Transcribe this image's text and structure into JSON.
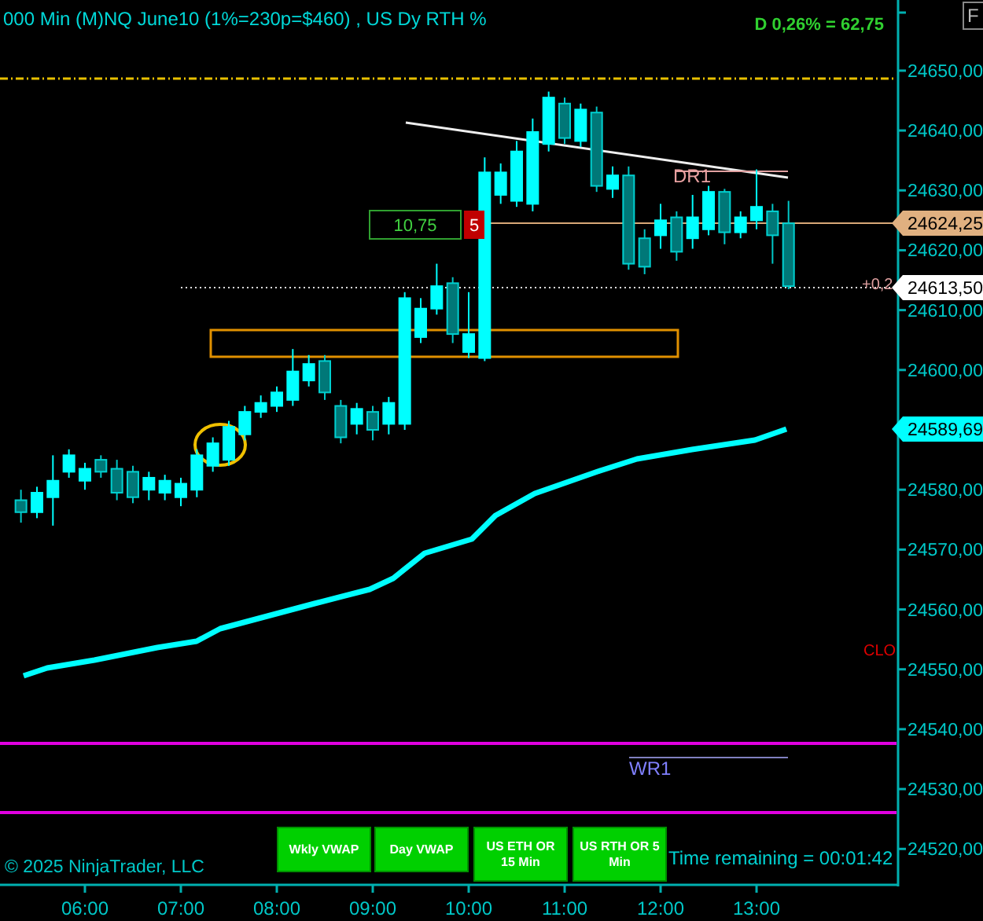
{
  "title": "000 Min (M)NQ June10 (1%=230p=$460) , US Dy RTH %",
  "daily_change": "D 0,26% = 62,75",
  "corner_button": "F",
  "price_chart": {
    "chart_data": {
      "type": "candlestick",
      "xlim": [
        306.9,
        868.5
      ],
      "ylim": [
        24514,
        24661.8
      ],
      "x": [
        320,
        330,
        340,
        350,
        360,
        370,
        380,
        390,
        400,
        410,
        420,
        430,
        440,
        450,
        460,
        470,
        480,
        490,
        500,
        510,
        520,
        530,
        540,
        550,
        560,
        570,
        580,
        590,
        600,
        610,
        620,
        630,
        640,
        650,
        660,
        670,
        680,
        690,
        700,
        710,
        720,
        730,
        740,
        750,
        760,
        770,
        780,
        790,
        800
      ],
      "xticks": [
        {
          "value": 360,
          "label": "06:00"
        },
        {
          "value": 420,
          "label": "07:00"
        },
        {
          "value": 480,
          "label": "08:00"
        },
        {
          "value": 540,
          "label": "09:00"
        },
        {
          "value": 600,
          "label": "10:00"
        },
        {
          "value": 660,
          "label": "11:00"
        },
        {
          "value": 720,
          "label": "12:00"
        },
        {
          "value": 780,
          "label": "13:00"
        }
      ],
      "yticks": [
        {
          "value": 24650,
          "label": "24650,00"
        },
        {
          "value": 24640,
          "label": "24640,00"
        },
        {
          "value": 24630,
          "label": "24630,00"
        },
        {
          "value": 24620,
          "label": "24620,00"
        },
        {
          "value": 24610,
          "label": "24610,00"
        },
        {
          "value": 24600,
          "label": "24600,00"
        },
        {
          "value": 24580,
          "label": "24580,00"
        },
        {
          "value": 24570,
          "label": "24570,00"
        },
        {
          "value": 24560,
          "label": "24560,00"
        },
        {
          "value": 24550,
          "label": "24550,00"
        },
        {
          "value": 24540,
          "label": "24540,00"
        },
        {
          "value": 24530,
          "label": "24530,00"
        },
        {
          "value": 24520,
          "label": "24520,00"
        }
      ],
      "ohlc": [
        [
          24578.25,
          24580,
          24574.5,
          24576.25
        ],
        [
          24576.25,
          24580.5,
          24575.25,
          24579.5
        ],
        [
          24578.75,
          24585.75,
          24574,
          24581.5
        ],
        [
          24583,
          24586.75,
          24582,
          24585.75
        ],
        [
          24581.5,
          24584.5,
          24580,
          24583.5
        ],
        [
          24585,
          24585.75,
          24582,
          24583
        ],
        [
          24583.5,
          24585,
          24578.25,
          24579.5
        ],
        [
          24583,
          24584,
          24577.75,
          24578.75
        ],
        [
          24580,
          24583,
          24578.25,
          24582
        ],
        [
          24579.5,
          24582.5,
          24578.25,
          24581.5
        ],
        [
          24578.75,
          24582,
          24577.25,
          24581
        ],
        [
          24580,
          24586.75,
          24578.75,
          24585.75
        ],
        [
          24584,
          24588.75,
          24583,
          24587.75
        ],
        [
          24585,
          24591.5,
          24584,
          24590.5
        ],
        [
          24589.25,
          24594,
          24588.25,
          24593
        ],
        [
          24593,
          24595.75,
          24592,
          24594.5
        ],
        [
          24594,
          24597.25,
          24593,
          24596.25
        ],
        [
          24595,
          24603.5,
          24594,
          24599.75
        ],
        [
          24598.25,
          24602.5,
          24597.25,
          24601
        ],
        [
          24601.5,
          24602.5,
          24595,
          24596.25
        ],
        [
          24594,
          24595,
          24587.75,
          24588.75
        ],
        [
          24591,
          24594.5,
          24589.25,
          24593.5
        ],
        [
          24593,
          24594,
          24588.25,
          24590
        ],
        [
          24591,
          24595.5,
          24589.25,
          24594.5
        ],
        [
          24591,
          24613,
          24590,
          24612
        ],
        [
          24605.5,
          24612,
          24604.5,
          24610.25
        ],
        [
          24610.25,
          24617.75,
          24609.25,
          24614
        ],
        [
          24614.5,
          24615.5,
          24604.5,
          24606
        ],
        [
          24603,
          24613,
          24602,
          24606
        ],
        [
          24602,
          24635.5,
          24601.5,
          24633
        ],
        [
          24629.25,
          24634.5,
          24627.75,
          24633
        ],
        [
          24628.25,
          24638.25,
          24627.25,
          24636.5
        ],
        [
          24627.75,
          24642,
          24626.5,
          24639.75
        ],
        [
          24637.75,
          24646.5,
          24636.5,
          24645.5
        ],
        [
          24644.5,
          24645.5,
          24637.75,
          24638.75
        ],
        [
          24638.25,
          24644.5,
          24637.25,
          24643.5
        ],
        [
          24643,
          24644,
          24629.75,
          24630.75
        ],
        [
          24630.25,
          24634,
          24628.75,
          24632.5
        ],
        [
          24632.5,
          24634,
          24616.75,
          24617.75
        ],
        [
          24622,
          24623.5,
          24616,
          24617.25
        ],
        [
          24622.5,
          24627.75,
          24620.25,
          24625
        ],
        [
          24625.5,
          24626.5,
          24618.25,
          24619.75
        ],
        [
          24622,
          24629.25,
          24620.25,
          24625.5
        ],
        [
          24623.5,
          24630.75,
          24622.5,
          24629.75
        ],
        [
          24629.75,
          24630.25,
          24621,
          24623
        ],
        [
          24623,
          24626.5,
          24622,
          24625.5
        ],
        [
          24625,
          24633.5,
          24623.5,
          24627.25
        ],
        [
          24626.5,
          24627.75,
          24617.75,
          24622.5
        ],
        [
          24624.5,
          24628.25,
          24613.5,
          24614
        ]
      ]
    }
  },
  "price_markers": [
    {
      "text": "24624,25",
      "kind": "position"
    },
    {
      "text": "24613,50",
      "kind": "last"
    },
    {
      "text": "24589,69",
      "kind": "average"
    }
  ],
  "position_box": {
    "profit": "10,75",
    "quantity": "5"
  },
  "labels": [
    {
      "text": "DR1",
      "kind": "daily"
    },
    {
      "text": "WR1",
      "kind": "weekly"
    },
    {
      "text": "CLO",
      "kind": "close"
    },
    {
      "text": "+0,2",
      "kind": "offset"
    }
  ],
  "indicator_buttons": [
    "Wkly VWAP",
    "Day VWAP",
    "US ETH OR 15 Min",
    "US RTH OR 5 Min"
  ],
  "time_remaining": "Time remaining = 00:01:42",
  "copyright": "© 2025 NinjaTrader, LLC"
}
